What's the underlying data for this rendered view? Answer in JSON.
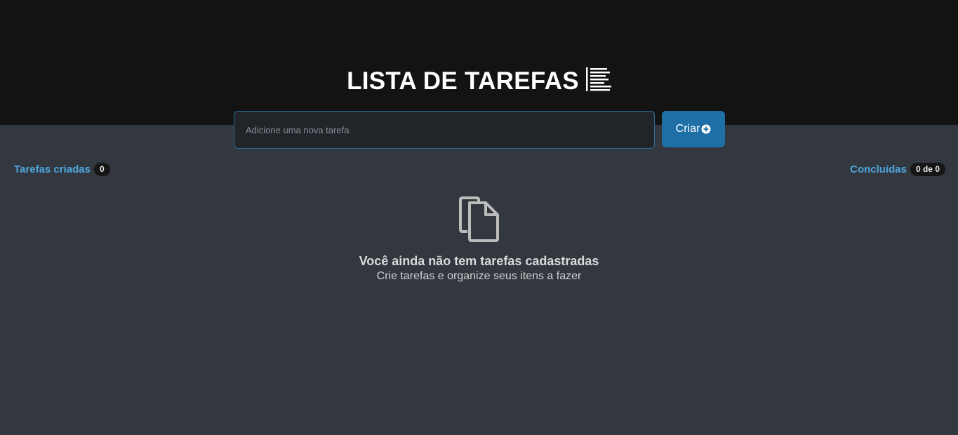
{
  "header": {
    "title": "LISTA DE TAREFAS",
    "title_icon": "list-lines-icon"
  },
  "form": {
    "placeholder": "Adicione uma nova tarefa",
    "value": "",
    "button_label": "Criar",
    "button_icon": "plus-circle-icon"
  },
  "counters": {
    "created_label": "Tarefas criadas",
    "created_count": "0",
    "done_label": "Concluídas",
    "done_count": "0 de 0"
  },
  "empty": {
    "icon": "documents-icon",
    "title": "Você ainda não tem tarefas cadastradas",
    "subtitle": "Crie tarefas e organize seus itens a fazer"
  },
  "colors": {
    "header_bg": "#131313",
    "page_bg": "#33373f",
    "accent": "#4ea8de",
    "button": "#1e6fa6"
  }
}
